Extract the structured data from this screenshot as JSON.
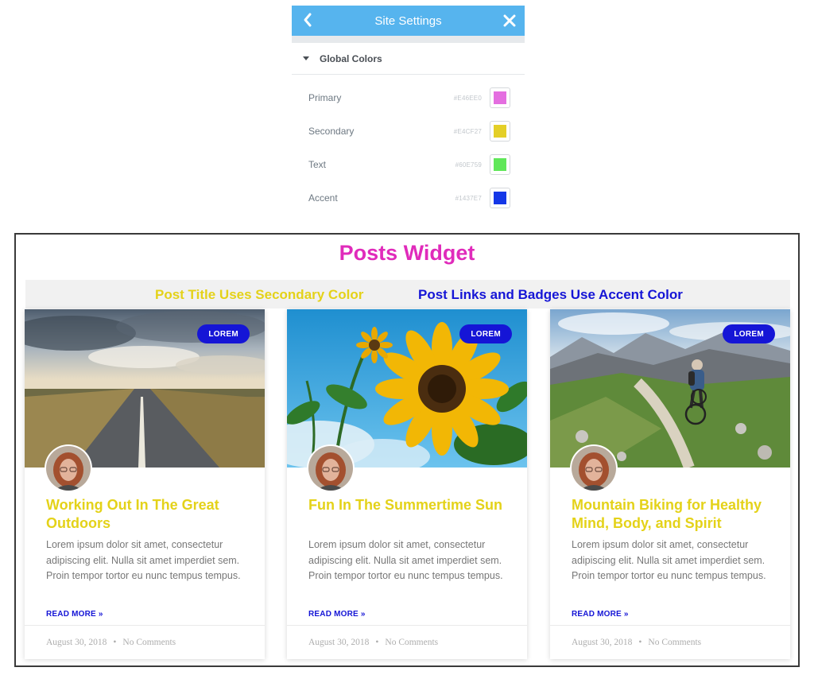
{
  "panel": {
    "title": "Site Settings",
    "section": "Global Colors",
    "header_color": "#56b4ee",
    "colors": [
      {
        "label": "Primary",
        "hex": "#E46EE0"
      },
      {
        "label": "Secondary",
        "hex": "#E4CF27"
      },
      {
        "label": "Text",
        "hex": "#60E759"
      },
      {
        "label": "Accent",
        "hex": "#1437E7"
      }
    ]
  },
  "widget": {
    "title": "Posts Widget",
    "title_color": "#e02bbb",
    "note_secondary": "Post Title Uses Secondary Color",
    "note_accent": "Post Links and Badges Use Accent Color",
    "secondary_color": "#e4d219",
    "accent_color": "#1515d6"
  },
  "posts": [
    {
      "badge": "LOREM",
      "title": "Working Out In The Great Outdoors",
      "image": "road-landscape-image",
      "excerpt": "Lorem ipsum dolor sit amet, consectetur adipiscing elit. Nulla sit amet imperdiet sem. Proin tempor tortor eu nunc tempus tempus.",
      "read_more": "READ MORE »",
      "date": "August 30, 2018",
      "separator": "•",
      "comments": "No Comments"
    },
    {
      "badge": "LOREM",
      "title": "Fun In The Summertime Sun",
      "image": "sunflower-image",
      "excerpt": "Lorem ipsum dolor sit amet, consectetur adipiscing elit. Nulla sit amet imperdiet sem. Proin tempor tortor eu nunc tempus tempus.",
      "read_more": "READ MORE »",
      "date": "August 30, 2018",
      "separator": "•",
      "comments": "No Comments"
    },
    {
      "badge": "LOREM",
      "title": "Mountain Biking for Healthy Mind, Body, and Spirit",
      "image": "mountain-biker-image",
      "excerpt": "Lorem ipsum dolor sit amet, consectetur adipiscing elit. Nulla sit amet imperdiet sem. Proin tempor tortor eu nunc tempus tempus.",
      "read_more": "READ MORE »",
      "date": "August 30, 2018",
      "separator": "•",
      "comments": "No Comments"
    }
  ]
}
